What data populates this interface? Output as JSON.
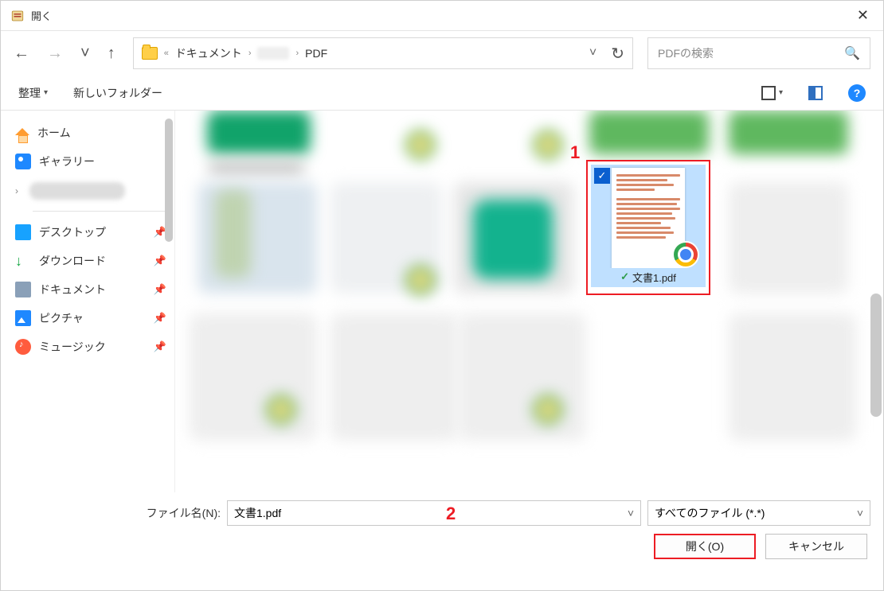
{
  "window": {
    "title": "開く"
  },
  "breadcrumb": {
    "pre_symbol": "«",
    "item1": "ドキュメント",
    "item2": "PDF",
    "dropdown_icon": "˅",
    "refresh_icon": "↻"
  },
  "search": {
    "placeholder": "PDFの検索"
  },
  "toolbar": {
    "organize": "整理",
    "new_folder": "新しいフォルダー"
  },
  "sidebar": {
    "home": "ホーム",
    "gallery": "ギャラリー",
    "desktop": "デスクトップ",
    "downloads": "ダウンロード",
    "documents": "ドキュメント",
    "pictures": "ピクチャ",
    "music": "ミュージック"
  },
  "selected_file": {
    "name": "文書1.pdf",
    "checkmark": "✓",
    "synced": "✓"
  },
  "callouts": {
    "one": "1",
    "two": "2"
  },
  "footer": {
    "filename_label": "ファイル名(N):",
    "filename_value": "文書1.pdf",
    "filter_value": "すべてのファイル (*.*)",
    "open_button": "開く(O)",
    "cancel_button": "キャンセル"
  }
}
